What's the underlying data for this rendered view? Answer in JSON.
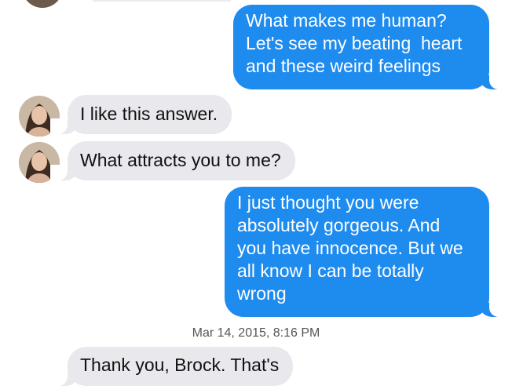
{
  "conversation": {
    "messages": [
      {
        "direction": "outgoing",
        "text": "What makes me human?\nLet's see my beating  heart\nand these weird feelings"
      },
      {
        "direction": "incoming",
        "text": "I like this answer."
      },
      {
        "direction": "incoming",
        "text": "What attracts you to me?"
      },
      {
        "direction": "outgoing",
        "text": "I just thought you were\nabsolutely gorgeous. And\nyou have innocence. But we\nall know I can be totally\nwrong"
      },
      {
        "direction": "incoming",
        "text": "Thank you, Brock. That's"
      }
    ],
    "timestamp": "Mar 14, 2015, 8:16 PM"
  },
  "colors": {
    "outgoing_bubble": "#1e8bef",
    "incoming_bubble": "#e8e8ed",
    "background": "#ffffff",
    "timestamp_text": "#555555"
  },
  "icons": {
    "avatar": "contact-avatar-photo"
  }
}
